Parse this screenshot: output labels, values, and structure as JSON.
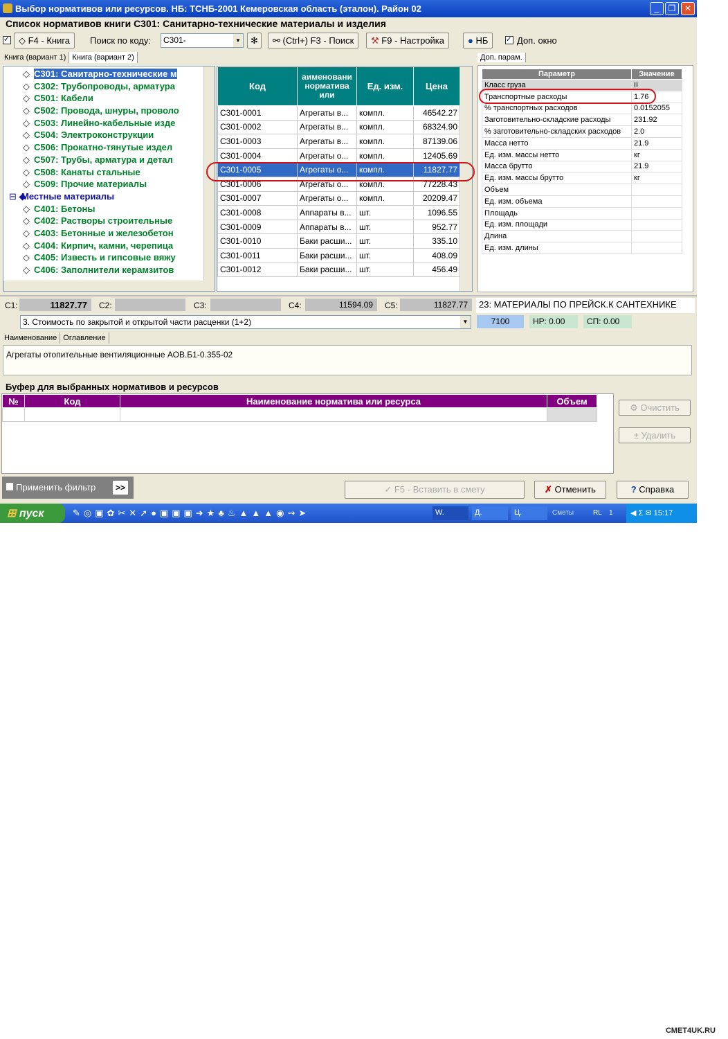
{
  "window": {
    "title": "Выбор нормативов или ресурсов. НБ: ТСНБ-2001 Кемеровская область (эталон). Район 02",
    "heading": "Список нормативов книги С301: Санитарно-технические материалы и изделия"
  },
  "toolbar": {
    "book_label": "F4 - Книга",
    "search_label": "Поиск по коду:",
    "search_value": "С301-",
    "find_label": "(Ctrl+) F3 - Поиск",
    "settings_label": "F9 - Настройка",
    "nb_label": "НБ",
    "extra_window_label": "Доп. окно"
  },
  "tabs": [
    "Книга (вариант 1)",
    "Книга (вариант 2)"
  ],
  "tree": [
    {
      "label": "С301: Санитарно-технические м",
      "selected": true
    },
    {
      "label": "С302: Трубопроводы, арматура"
    },
    {
      "label": "С501: Кабели"
    },
    {
      "label": "С502: Провода, шнуры, проволо"
    },
    {
      "label": "С503: Линейно-кабельные изде"
    },
    {
      "label": "С504: Электроконструкции"
    },
    {
      "label": "С506: Прокатно-тянутые издел"
    },
    {
      "label": "С507: Трубы, арматура и детал"
    },
    {
      "label": "С508: Канаты стальные"
    },
    {
      "label": "С509: Прочие материалы"
    },
    {
      "label": "Местные материалы",
      "group": true
    },
    {
      "label": "С401: Бетоны"
    },
    {
      "label": "С402: Растворы строительные"
    },
    {
      "label": "С403: Бетонные и железобетон"
    },
    {
      "label": "С404: Кирпич, камни, черепица"
    },
    {
      "label": "С405: Известь и гипсовые вяжу"
    },
    {
      "label": "С406: Заполнители керамзитов"
    }
  ],
  "grid": {
    "headers": [
      "Код",
      "аименовани норматива или",
      "Ед. изм.",
      "Цена"
    ],
    "rows": [
      [
        "С301-0001",
        "Агрегаты в...",
        "компл.",
        "46542.27"
      ],
      [
        "С301-0002",
        "Агрегаты в...",
        "компл.",
        "68324.90"
      ],
      [
        "С301-0003",
        "Агрегаты в...",
        "компл.",
        "87139.06"
      ],
      [
        "С301-0004",
        "Агрегаты о...",
        "компл.",
        "12405.69"
      ],
      [
        "С301-0005",
        "Агрегаты о...",
        "компл.",
        "11827.77"
      ],
      [
        "С301-0006",
        "Агрегаты о...",
        "компл.",
        "77228.43"
      ],
      [
        "С301-0007",
        "Агрегаты о...",
        "компл.",
        "20209.47"
      ],
      [
        "С301-0008",
        "Аппараты в...",
        "шт.",
        "1096.55"
      ],
      [
        "С301-0009",
        "Аппараты в...",
        "шт.",
        "952.77"
      ],
      [
        "С301-0010",
        "Баки расши...",
        "шт.",
        "335.10"
      ],
      [
        "С301-0011",
        "Баки расши...",
        "шт.",
        "408.09"
      ],
      [
        "С301-0012",
        "Баки расши...",
        "шт.",
        "456.49"
      ]
    ],
    "selected_index": 4
  },
  "params": {
    "tab": "Доп. парам.",
    "headers": [
      "Параметр",
      "Значение"
    ],
    "rows": [
      [
        "Класс груза",
        "II"
      ],
      [
        "Транспортные расходы",
        "1.76"
      ],
      [
        "% транспортных расходов",
        "0.0152055"
      ],
      [
        "Заготовительно-складские расходы",
        "231.92"
      ],
      [
        "% заготовительно-складских расходов",
        "2.0"
      ],
      [
        "Масса нетто",
        "21.9"
      ],
      [
        "Ед. изм. массы нетто",
        "кг"
      ],
      [
        "Масса брутто",
        "21.9"
      ],
      [
        "Ед. изм. массы брутто",
        "кг"
      ],
      [
        "Объем",
        ""
      ],
      [
        "Ед. изм. объема",
        ""
      ],
      [
        "Площадь",
        ""
      ],
      [
        "Ед. изм. площади",
        ""
      ],
      [
        "Длина",
        ""
      ],
      [
        "Ед. изм. длины",
        ""
      ]
    ]
  },
  "costs": {
    "c1_label": "С1:",
    "c1": "11827.77",
    "c2_label": "С2:",
    "c2": "",
    "c3_label": "С3:",
    "c3": "",
    "c4_label": "С4:",
    "c4": "11594.09",
    "c5_label": "С5:",
    "c5": "11827.77",
    "category": "23: МАТЕРИАЛЫ ПО ПРЕЙСК.К САНТЕХНИКЕ",
    "cost_type": "3. Стоимость по закрытой и открытой части расценки (1+2)",
    "code": "7100",
    "nr": "НР: 0.00",
    "sp": "СП: 0.00"
  },
  "desc": {
    "tabs": [
      "Наименование",
      "Оглавление"
    ],
    "text": "Агрегаты отопительные вентиляционные АОВ.Б1-0.355-02"
  },
  "buffer": {
    "title": "Буфер для выбранных нормативов и ресурсов",
    "headers": [
      "№",
      "Код",
      "Наименование норматива или ресурса",
      "Объем"
    ],
    "clear": "Очистить",
    "delete": "Удалить"
  },
  "footer": {
    "filter": "Применить фильтр",
    "more": ">>",
    "insert": "F5 - Вставить в смету",
    "cancel": "Отменить",
    "help": "Справка"
  },
  "taskbar": {
    "start": "пуск",
    "tasks": [
      "W.",
      "Д.",
      "Ц."
    ],
    "tray_text": "Сметы",
    "lang": "RL",
    "num": "1",
    "time": "15:17"
  },
  "watermark": "СМЕТ4UK.RU"
}
